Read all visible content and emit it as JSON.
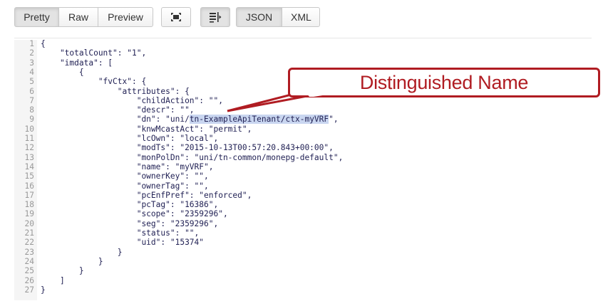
{
  "toolbar": {
    "view_buttons": [
      "Pretty",
      "Raw",
      "Preview"
    ],
    "active_view": "Pretty",
    "format_buttons": [
      "JSON",
      "XML"
    ],
    "active_format": "JSON",
    "icons": [
      "collapse-icon",
      "wrap-lines-icon"
    ]
  },
  "code": {
    "lines": [
      {
        "n": "1",
        "text": "{"
      },
      {
        "n": "2",
        "text": "    \"totalCount\": \"1\","
      },
      {
        "n": "3",
        "text": "    \"imdata\": ["
      },
      {
        "n": "4",
        "text": "        {"
      },
      {
        "n": "5",
        "text": "            \"fvCtx\": {"
      },
      {
        "n": "6",
        "text": "                \"attributes\": {"
      },
      {
        "n": "7",
        "text": "                    \"childAction\": \"\","
      },
      {
        "n": "8",
        "text": "                    \"descr\": \"\","
      },
      {
        "n": "9",
        "pre": "                    \"dn\": \"uni/",
        "hl": "tn-ExampleApiTenant/ctx-myVRF",
        "post": "\","
      },
      {
        "n": "10",
        "text": "                    \"knwMcastAct\": \"permit\","
      },
      {
        "n": "11",
        "text": "                    \"lcOwn\": \"local\","
      },
      {
        "n": "12",
        "text": "                    \"modTs\": \"2015-10-13T00:57:20.843+00:00\","
      },
      {
        "n": "13",
        "text": "                    \"monPolDn\": \"uni/tn-common/monepg-default\","
      },
      {
        "n": "14",
        "text": "                    \"name\": \"myVRF\","
      },
      {
        "n": "15",
        "text": "                    \"ownerKey\": \"\","
      },
      {
        "n": "16",
        "text": "                    \"ownerTag\": \"\","
      },
      {
        "n": "17",
        "text": "                    \"pcEnfPref\": \"enforced\","
      },
      {
        "n": "18",
        "text": "                    \"pcTag\": \"16386\","
      },
      {
        "n": "19",
        "text": "                    \"scope\": \"2359296\","
      },
      {
        "n": "20",
        "text": "                    \"seg\": \"2359296\","
      },
      {
        "n": "21",
        "text": "                    \"status\": \"\","
      },
      {
        "n": "22",
        "text": "                    \"uid\": \"15374\""
      },
      {
        "n": "23",
        "text": "                }"
      },
      {
        "n": "24",
        "text": "            }"
      },
      {
        "n": "25",
        "text": "        }"
      },
      {
        "n": "26",
        "text": "    ]"
      },
      {
        "n": "27",
        "text": "}"
      }
    ]
  },
  "callout": {
    "text": "Distinguished Name",
    "color": "#b01c22"
  },
  "colors": {
    "highlight": "#c9d6f0",
    "code_text": "#222255",
    "line_number": "#999999"
  }
}
